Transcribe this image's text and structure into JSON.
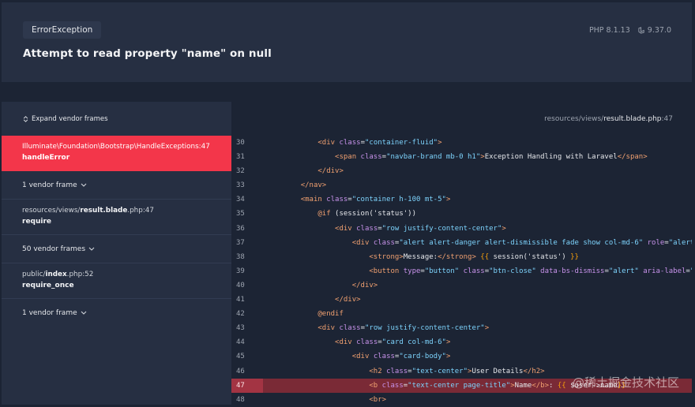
{
  "header": {
    "exception_class": "ErrorException",
    "message": "Attempt to read property \"name\" on null",
    "php_version": "PHP 8.1.13",
    "laravel_version": "9.37.0"
  },
  "stack": {
    "expand_label": "Expand vendor frames",
    "frames": [
      {
        "file": "Illuminate\\Foundation\\Bootstrap\\HandleExceptions",
        "line": ":47",
        "fn": "handleError"
      },
      {
        "vendor": "1 vendor frame"
      },
      {
        "file_prefix": "resources/views/",
        "file_bold": "result.blade",
        "file_suffix": ".php",
        "line": ":47",
        "fn": "require"
      },
      {
        "vendor": "50 vendor frames"
      },
      {
        "file_prefix": "public/",
        "file_bold": "index",
        "file_suffix": ".php",
        "line": ":52",
        "fn": "require_once"
      },
      {
        "vendor": "1 vendor frame"
      }
    ]
  },
  "source": {
    "path_prefix": "resources/views/",
    "path_bold": "result.blade.php",
    "path_line": ":47",
    "highlight_line": "47",
    "lines": [
      {
        "n": "30"
      },
      {
        "n": "31"
      },
      {
        "n": "32"
      },
      {
        "n": "33"
      },
      {
        "n": "34"
      },
      {
        "n": "35"
      },
      {
        "n": "36"
      },
      {
        "n": "37"
      },
      {
        "n": "38"
      },
      {
        "n": "39"
      },
      {
        "n": "40"
      },
      {
        "n": "41"
      },
      {
        "n": "42"
      },
      {
        "n": "43"
      },
      {
        "n": "44"
      },
      {
        "n": "45"
      },
      {
        "n": "46"
      },
      {
        "n": "47"
      },
      {
        "n": "48"
      }
    ]
  },
  "watermark": "@稀土掘金技术社区"
}
